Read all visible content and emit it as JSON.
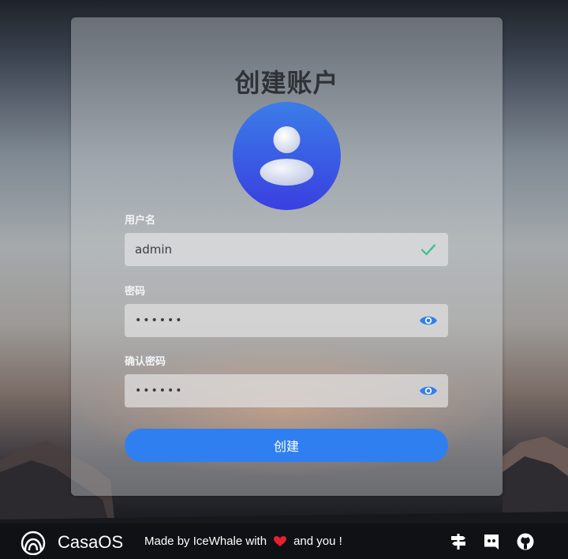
{
  "form": {
    "title": "创建账户",
    "username_label": "用户名",
    "username_value": "admin",
    "password_label": "密码",
    "password_value": "••••••",
    "confirm_label": "确认密码",
    "confirm_value": "••••••",
    "submit_label": "创建"
  },
  "footer": {
    "brand": "CasaOS",
    "made_by": "Made by IceWhale with",
    "and_you": "and you !",
    "icons": [
      "signpost-icon",
      "discord-icon",
      "github-icon"
    ]
  },
  "colors": {
    "accent": "#2f7ff0",
    "valid_check": "#35c08a",
    "eye_icon": "#2f7ff0",
    "heart": "#e8202e"
  }
}
